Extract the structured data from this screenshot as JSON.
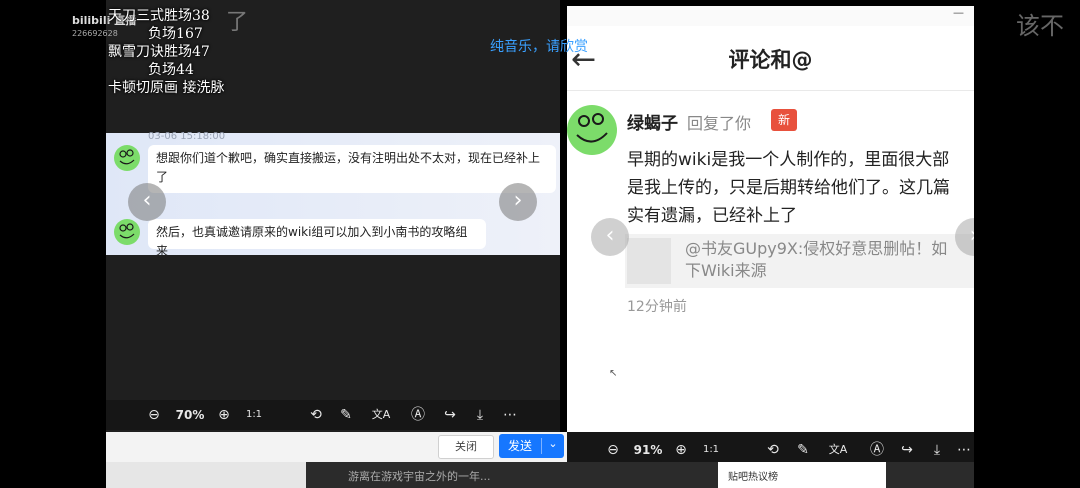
{
  "overlay": {
    "bili_logo": "bilibili 直播",
    "uid": "226692628",
    "top_mark": "了",
    "right_mark": "该不",
    "stats_lines": [
      "天刀三式胜场38",
      "         负场167",
      "飘雪刀诀胜场47",
      "         负场44",
      "卡顿切原画 接洗脉"
    ],
    "music_note": "纯音乐，请欣赏"
  },
  "left_viewer": {
    "timestamp": "03-06 15:18:00",
    "messages": [
      {
        "text": "想跟你们道个歉吧，确实直接搬运，没有注明出处不太对，现在已经补上了"
      },
      {
        "text": "然后，也真诚邀请原来的wiki组可以加入到小南书的攻略组来"
      }
    ],
    "zoom": "70%",
    "one_to_one": "1:1",
    "close_label": "关闭",
    "send_label": "发送",
    "dropdown_glyph": "⌄",
    "toolbar_glyphs": {
      "zoom_out": "⊖",
      "zoom_in": "⊕",
      "rotate": "⟲",
      "edit": "✎",
      "translate": "文A",
      "ocr": "Ⓐ",
      "share": "↪",
      "download": "⤓",
      "more": "⋯"
    }
  },
  "right_viewer": {
    "title": "评论和@",
    "back_glyph": "←",
    "minimize_glyph": "—",
    "commenter": "绿蝎子",
    "action": "回复了你",
    "new_badge": "新",
    "reply_lines": [
      "早期的wiki是我一个人制作的，里面很大部",
      "是我上传的，只是后期转给他们了。这几篇",
      "实有遗漏，已经补上了"
    ],
    "quoted_lines": [
      "@书友GUpy9X:侵权好意思删帖！如",
      "下Wiki来源"
    ],
    "time_ago": "12分钟前",
    "zoom": "91%",
    "one_to_one": "1:1"
  },
  "bottom": {
    "ticker": "游离在游戏宇宙之外的一年...",
    "hot_topic": "贴吧热议榜"
  },
  "colors": {
    "send_blue": "#1677ff",
    "new_badge": "#e8513d",
    "avatar_green": "#7cdc6a",
    "music_note": "#3aa0ff"
  }
}
